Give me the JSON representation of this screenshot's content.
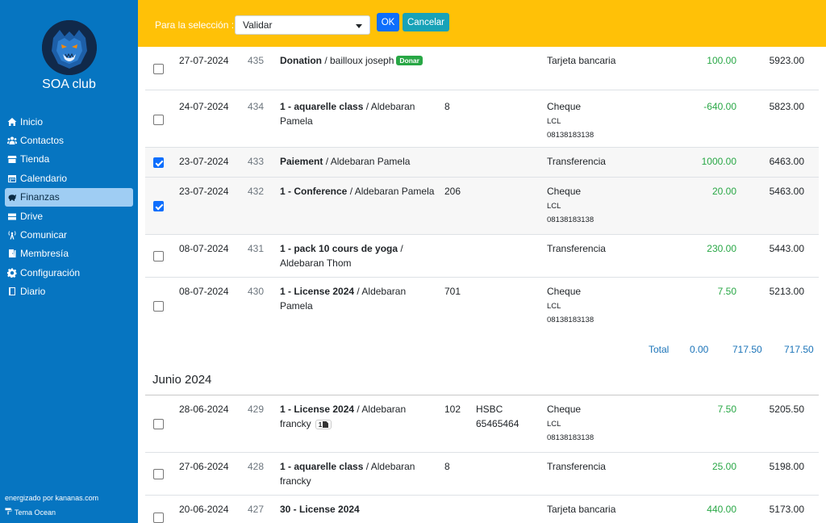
{
  "sidebar": {
    "club_name": "SOA club",
    "items": [
      {
        "label": "Inicio",
        "icon": "home-icon"
      },
      {
        "label": "Contactos",
        "icon": "users-icon"
      },
      {
        "label": "Tienda",
        "icon": "store-icon"
      },
      {
        "label": "Calendario",
        "icon": "calendar-icon"
      },
      {
        "label": "Finanzas",
        "icon": "piggy-bank-icon",
        "active": true
      },
      {
        "label": "Drive",
        "icon": "drive-icon"
      },
      {
        "label": "Comunicar",
        "icon": "broadcast-icon"
      },
      {
        "label": "Membresía",
        "icon": "door-icon"
      },
      {
        "label": "Configuración",
        "icon": "gear-icon"
      },
      {
        "label": "Diario",
        "icon": "book-icon"
      }
    ],
    "footer_powered": "energizado por kananas.com",
    "footer_theme": "Tema Ocean"
  },
  "toolbar": {
    "selection_label": "Para la selección :",
    "select_value": "Validar",
    "ok_label": "OK",
    "cancel_label": "Cancelar"
  },
  "rows": [
    {
      "date": "27-07-2024",
      "num": "435",
      "title": "Donation",
      "person": " / bailloux joseph",
      "badge": "Donar",
      "qty": "",
      "bank": "",
      "pay": "Tarjeta bancaria",
      "pay_sub": [],
      "amount": "100.00",
      "balance": "5923.00",
      "checked": false
    },
    {
      "date": "24-07-2024",
      "num": "434",
      "title": "1 - aquarelle class",
      "person": " / Aldebaran Pamela",
      "qty": "8",
      "bank": "",
      "pay": "Cheque",
      "pay_sub": [
        "LCL",
        "08138183138"
      ],
      "amount": "-640.00",
      "balance": "5823.00",
      "checked": false
    },
    {
      "date": "23-07-2024",
      "num": "433",
      "title": "Paiement",
      "person": " / Aldebaran Pamela",
      "qty": "",
      "bank": "",
      "pay": "Transferencia",
      "pay_sub": [],
      "amount": "1000.00",
      "balance": "6463.00",
      "checked": true
    },
    {
      "date": "23-07-2024",
      "num": "432",
      "title": "1 - Conference",
      "person": " / Aldebaran Pamela",
      "qty": "206",
      "bank": "",
      "pay": "Cheque",
      "pay_sub": [
        "LCL",
        "08138183138"
      ],
      "amount": "20.00",
      "balance": "5463.00",
      "checked": true
    },
    {
      "date": "08-07-2024",
      "num": "431",
      "title": "1 - pack 10 cours de yoga",
      "person": " / Aldebaran Thom",
      "qty": "",
      "bank": "",
      "pay": "Transferencia",
      "pay_sub": [],
      "amount": "230.00",
      "balance": "5443.00",
      "checked": false
    },
    {
      "date": "08-07-2024",
      "num": "430",
      "title": "1 - License 2024",
      "person": " / Aldebaran Pamela",
      "qty": "701",
      "bank": "",
      "pay": "Cheque",
      "pay_sub": [
        "LCL",
        "08138183138"
      ],
      "amount": "7.50",
      "balance": "5213.00",
      "checked": false
    }
  ],
  "totals": {
    "label": "Total",
    "col1": "0.00",
    "col2": "717.50",
    "col3": "717.50"
  },
  "month_heading": "Junio 2024",
  "rows2": [
    {
      "date": "28-06-2024",
      "num": "429",
      "title": "1 - License 2024",
      "person": " / Aldebaran francky",
      "attach": "1",
      "qty": "102",
      "bank": "HSBC 65465464",
      "pay": "Cheque",
      "pay_sub": [
        "LCL",
        "08138183138"
      ],
      "amount": "7.50",
      "balance": "5205.50",
      "checked": false
    },
    {
      "date": "27-06-2024",
      "num": "428",
      "title": "1 - aquarelle class",
      "person": " / Aldebaran francky",
      "qty": "8",
      "bank": "",
      "pay": "Transferencia",
      "pay_sub": [],
      "amount": "25.00",
      "balance": "5198.00",
      "checked": false
    },
    {
      "date": "20-06-2024",
      "num": "427",
      "title": "30 - License 2024",
      "person": "",
      "qty": "",
      "bank": "",
      "pay": "Tarjeta bancaria",
      "pay_sub": [],
      "amount": "440.00",
      "balance": "5173.00",
      "checked": false
    }
  ],
  "colors": {
    "sidebar": "#0675c1",
    "topbar": "#ffc107",
    "positive": "#28a745",
    "link": "#1a73b8"
  }
}
